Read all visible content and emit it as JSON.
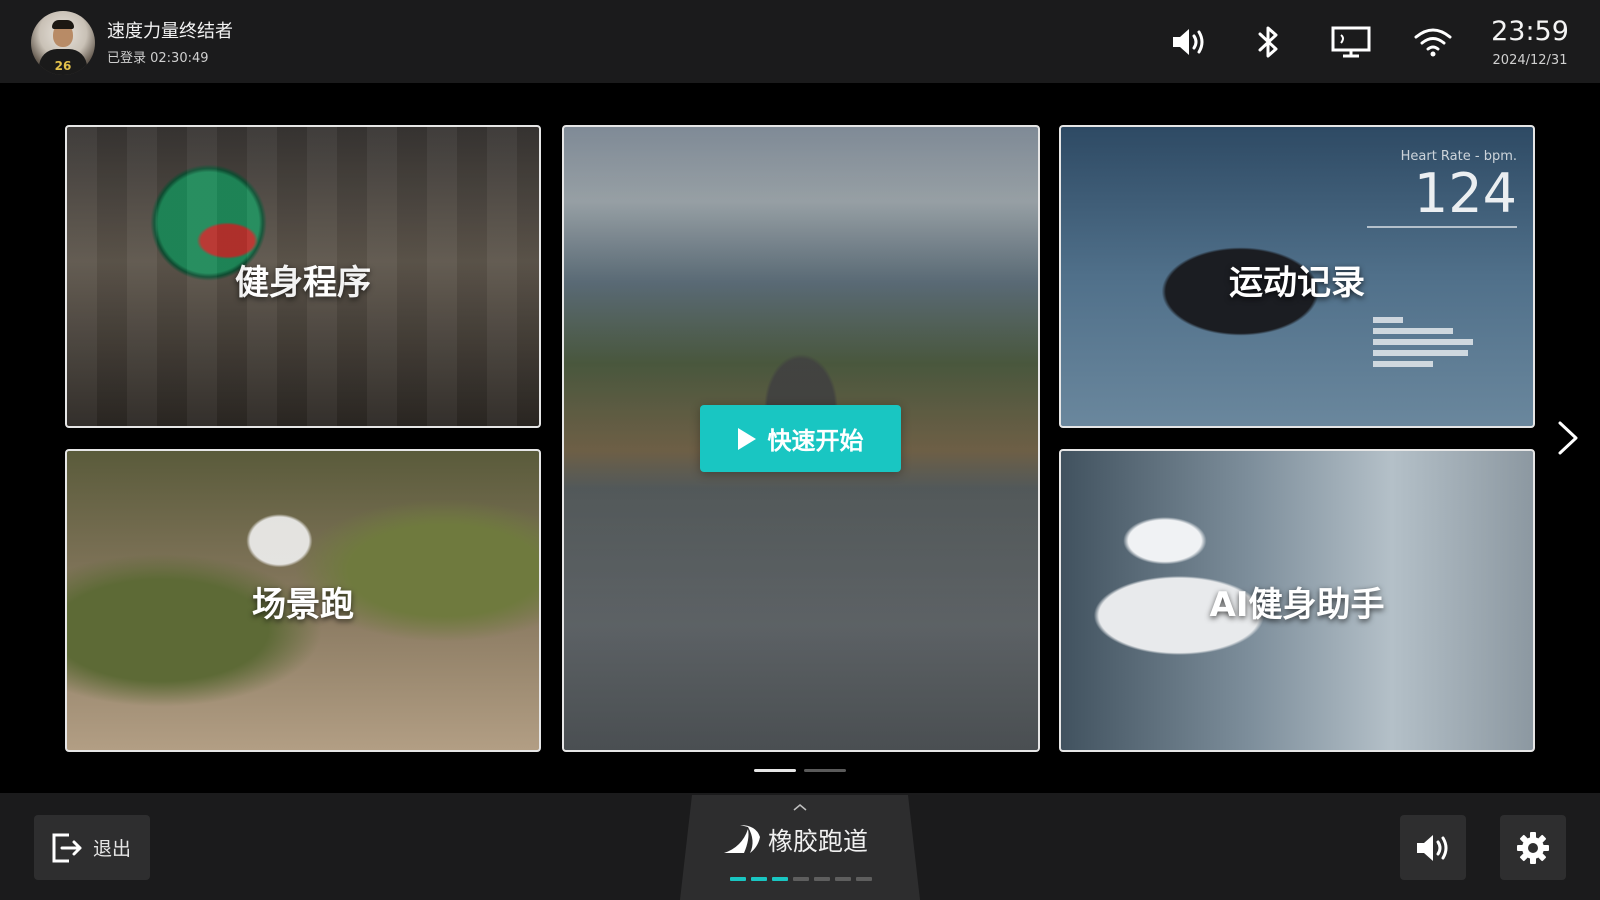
{
  "colors": {
    "accent": "#19c6c2",
    "bar_background": "#1b1b1c",
    "button_background": "#2e2e2f",
    "pager_active": "#e6e6e6",
    "pager_inactive": "#5a5a5a",
    "mode_dot_active": "#19c6c2",
    "mode_dot_inactive": "#5e5e5e"
  },
  "header": {
    "user": {
      "name": "速度力量终结者",
      "status": "已登录 02:30:49",
      "avatar_icon": "user-avatar",
      "jersey_number": "26"
    },
    "status_icons": [
      "volume-icon",
      "bluetooth-icon",
      "display-icon",
      "wifi-icon"
    ],
    "time": "23:59",
    "date": "2024/12/31"
  },
  "tiles": {
    "fitness_program": {
      "label": "健身程序"
    },
    "scene_run": {
      "label": "场景跑"
    },
    "quick_start": {
      "button_label": "快速开始",
      "icon": "play-icon"
    },
    "workout_records": {
      "label": "运动记录",
      "heart_rate_title": "Heart Rate - bpm.",
      "heart_rate_value": "124"
    },
    "ai_assistant": {
      "label": "AI健身助手"
    }
  },
  "carousel": {
    "next_icon": "chevron-right-icon",
    "pages": 2,
    "active_page": 1
  },
  "footer": {
    "exit": {
      "label": "退出",
      "icon": "exit-icon"
    },
    "mode": {
      "label": "橡胶跑道",
      "icon": "running-track-icon",
      "expand_icon": "chevron-up-icon",
      "levels_total": 7,
      "levels_active": 3
    },
    "volume_icon": "volume-icon",
    "settings_icon": "gear-icon"
  }
}
